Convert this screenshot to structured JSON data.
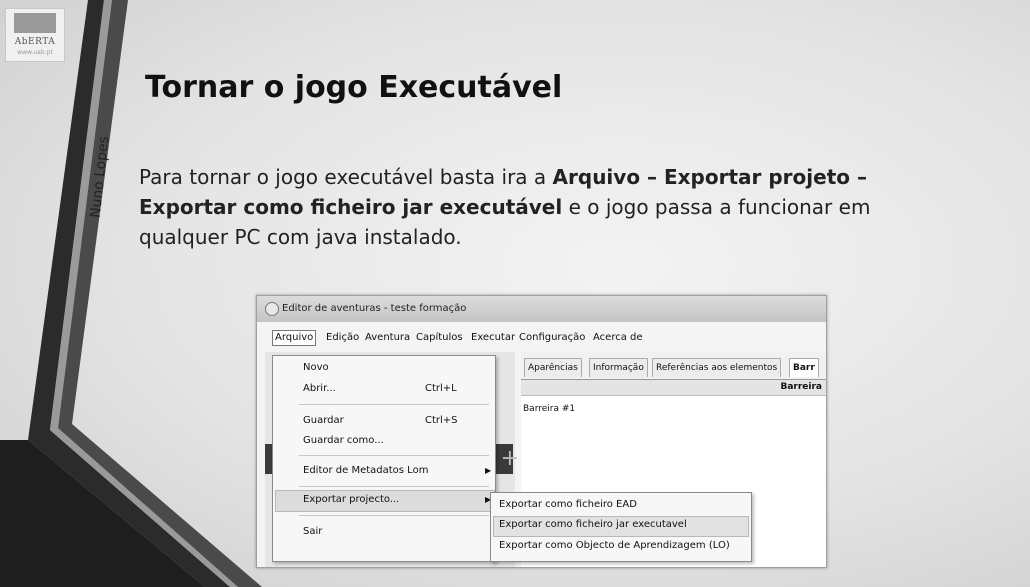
{
  "logo": {
    "name": "AbERTA",
    "url": "www.uab.pt"
  },
  "author": "Nuno Lopes",
  "slide": {
    "title": "Tornar o jogo Executável",
    "text_1": "Para tornar o jogo executável basta ira a ",
    "bold_1": "Arquivo – Exportar projeto – Exportar como ficheiro jar executável",
    "text_2": " e o jogo passa a funcionar em qualquer PC com java instalado."
  },
  "window": {
    "title": "Editor de aventuras - teste formação"
  },
  "menubar": [
    "Arquivo",
    "Edição",
    "Aventura",
    "Capítulos",
    "Executar",
    "Configuração",
    "Acerca de"
  ],
  "tabs": [
    "Aparências",
    "Informação",
    "Referências aos elementos",
    "Barr"
  ],
  "grid": {
    "header": "Barreira",
    "row": "Barreira #1"
  },
  "file_menu": {
    "novo": "Novo",
    "abrir": "Abrir...",
    "abrir_shortcut": "Ctrl+L",
    "guardar": "Guardar",
    "guardar_shortcut": "Ctrl+S",
    "guardar_como": "Guardar como...",
    "editor_metadatos": "Editor de Metadatos Lom",
    "exportar": "Exportar projecto...",
    "sair": "Sair"
  },
  "export_submenu": [
    "Exportar como ficheiro EAD",
    "Exportar como ficheiro jar executavel",
    "Exportar como Objecto de Aprendizagem (LO)"
  ]
}
